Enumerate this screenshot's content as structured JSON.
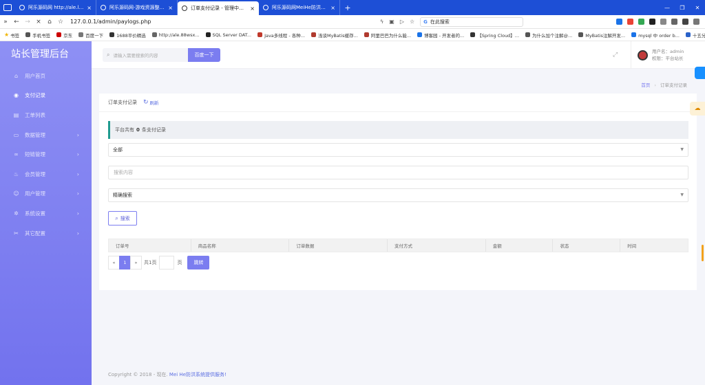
{
  "browser": {
    "tabs": [
      {
        "title": "阿乐源码网 http://ale.leleyangya",
        "active": false
      },
      {
        "title": "阿乐源码网-游戏资源整合网站-5",
        "active": false
      },
      {
        "title": "订单支付记录 - 管理中心平台",
        "active": true
      },
      {
        "title": "阿乐源码网MeiHe防洪版本系统",
        "active": false
      }
    ],
    "url": "127.0.0.1/admin/paylogs.php",
    "search_placeholder": "在此搜索",
    "bookmarks": [
      "书签",
      "手机书签",
      "京东",
      "百度一下",
      "1688平价精选",
      "http://ale.88wsx...",
      "SQL Server DAT...",
      "Java多线程 - 各种...",
      "浅谈MyBatis缓存...",
      "阿里巴巴为什么能...",
      "博客园 - 开发者的...",
      "【Spring Cloud】...",
      "为什么加个注解@...",
      "MyBatis注解开发...",
      "mysql 中 order b...",
      "十五分钟用Spri..."
    ]
  },
  "sidebar": {
    "brand": "站长管理后台",
    "items": [
      {
        "label": "用户首页",
        "icon": "⌂",
        "has_arrow": false,
        "active": false
      },
      {
        "label": "支付记录",
        "icon": "◉",
        "has_arrow": false,
        "active": true
      },
      {
        "label": "工单列表",
        "icon": "▤",
        "has_arrow": false,
        "active": false
      },
      {
        "label": "数据管理",
        "icon": "▭",
        "has_arrow": true,
        "active": false
      },
      {
        "label": "短链管理",
        "icon": "∞",
        "has_arrow": true,
        "active": false
      },
      {
        "label": "会员管理",
        "icon": "♨",
        "has_arrow": true,
        "active": false
      },
      {
        "label": "用户管理",
        "icon": "☺",
        "has_arrow": true,
        "active": false
      },
      {
        "label": "系统设置",
        "icon": "✲",
        "has_arrow": true,
        "active": false
      },
      {
        "label": "其它配置",
        "icon": "✂",
        "has_arrow": true,
        "active": false
      }
    ]
  },
  "header": {
    "search_placeholder": "请输入需要搜索的内容",
    "search_button": "百度一下",
    "user_name": "用户名：admin",
    "user_role": "权限：平台站长"
  },
  "breadcrumb": {
    "home": "首页",
    "sep": "›",
    "current": "订单支付记录"
  },
  "card": {
    "title": "订单支付记录",
    "refresh": "刷新",
    "alert_prefix": "平台共有",
    "alert_count": "0",
    "alert_suffix": "条支付记录",
    "filter_select": "全部",
    "search_input_placeholder": "搜索内容",
    "mode_select": "精确搜索",
    "search_button": "搜索",
    "columns": [
      "订单号",
      "商品名称",
      "订单数据",
      "支付方式",
      "金额",
      "状态",
      "时间"
    ],
    "pager": {
      "prev": "«",
      "current": "1",
      "next": "»",
      "total_text": "共1页",
      "page_unit": "页",
      "go": "跳转"
    }
  },
  "footer": {
    "text": "Copyright © 2018 - 现在.",
    "link": "Mei He防洪系统提供服务!"
  }
}
